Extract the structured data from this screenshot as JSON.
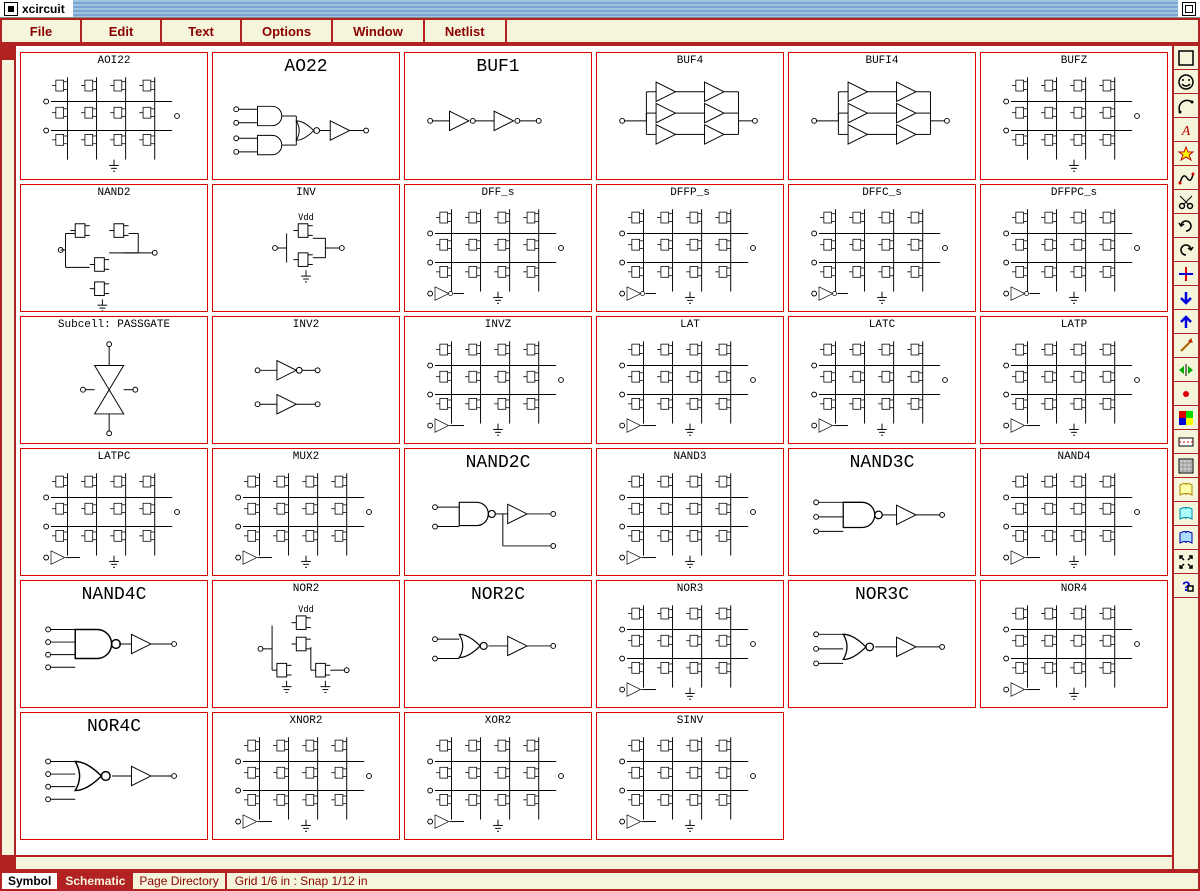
{
  "window": {
    "title": "xcircuit"
  },
  "menu": {
    "items": [
      "File",
      "Edit",
      "Text",
      "Options",
      "Window",
      "Netlist"
    ]
  },
  "library": {
    "cells": [
      {
        "label": "AOI22",
        "big": false,
        "sym": "complex"
      },
      {
        "label": "AO22",
        "big": true,
        "sym": "ao22"
      },
      {
        "label": "BUF1",
        "big": true,
        "sym": "buf1"
      },
      {
        "label": "BUF4",
        "big": false,
        "sym": "buf4"
      },
      {
        "label": "BUFI4",
        "big": false,
        "sym": "buf4"
      },
      {
        "label": "BUFZ",
        "big": false,
        "sym": "complex"
      },
      {
        "label": "NAND2",
        "big": false,
        "sym": "nand2t"
      },
      {
        "label": "INV",
        "big": false,
        "sym": "inv"
      },
      {
        "label": "DFF_s",
        "big": false,
        "sym": "complex2"
      },
      {
        "label": "DFFP_s",
        "big": false,
        "sym": "complex2"
      },
      {
        "label": "DFFC_s",
        "big": false,
        "sym": "complex2"
      },
      {
        "label": "DFFPC_s",
        "big": false,
        "sym": "complex2"
      },
      {
        "label": "Subcell: PASSGATE",
        "big": false,
        "sym": "passgate"
      },
      {
        "label": "INV2",
        "big": false,
        "sym": "inv2"
      },
      {
        "label": "INVZ",
        "big": false,
        "sym": "complex3"
      },
      {
        "label": "LAT",
        "big": false,
        "sym": "complex3"
      },
      {
        "label": "LATC",
        "big": false,
        "sym": "complex3"
      },
      {
        "label": "LATP",
        "big": false,
        "sym": "complex3"
      },
      {
        "label": "LATPC",
        "big": false,
        "sym": "complex3"
      },
      {
        "label": "MUX2",
        "big": false,
        "sym": "complex3"
      },
      {
        "label": "NAND2C",
        "big": true,
        "sym": "nand2c"
      },
      {
        "label": "NAND3",
        "big": false,
        "sym": "complex3"
      },
      {
        "label": "NAND3C",
        "big": true,
        "sym": "nand3c"
      },
      {
        "label": "NAND4",
        "big": false,
        "sym": "complex3"
      },
      {
        "label": "NAND4C",
        "big": true,
        "sym": "nand4c"
      },
      {
        "label": "NOR2",
        "big": false,
        "sym": "nor2t"
      },
      {
        "label": "NOR2C",
        "big": true,
        "sym": "nor2c"
      },
      {
        "label": "NOR3",
        "big": false,
        "sym": "complex3"
      },
      {
        "label": "NOR3C",
        "big": true,
        "sym": "nor3c"
      },
      {
        "label": "NOR4",
        "big": false,
        "sym": "complex3"
      },
      {
        "label": "NOR4C",
        "big": true,
        "sym": "nor4c"
      },
      {
        "label": "XNOR2",
        "big": false,
        "sym": "complex3"
      },
      {
        "label": "XOR2",
        "big": false,
        "sym": "complex3"
      },
      {
        "label": "SINV",
        "big": false,
        "sym": "complex3"
      }
    ]
  },
  "toolbar": {
    "icons": [
      "empty-box",
      "circle-smile",
      "arc",
      "text-a",
      "star-cursor",
      "curve",
      "scissors",
      "rotate-cw",
      "rotate-ccw",
      "cross",
      "down-arrow",
      "up-arrow",
      "wand",
      "mirror-arrows",
      "dot",
      "colors",
      "dashed",
      "grid",
      "book1",
      "book2",
      "book3",
      "zoom-full",
      "help"
    ]
  },
  "statusbar": {
    "symbol": "Symbol",
    "schematic": "Schematic",
    "page_directory": "Page Directory",
    "status": "Grid 1/6 in : Snap 1/12 in"
  }
}
